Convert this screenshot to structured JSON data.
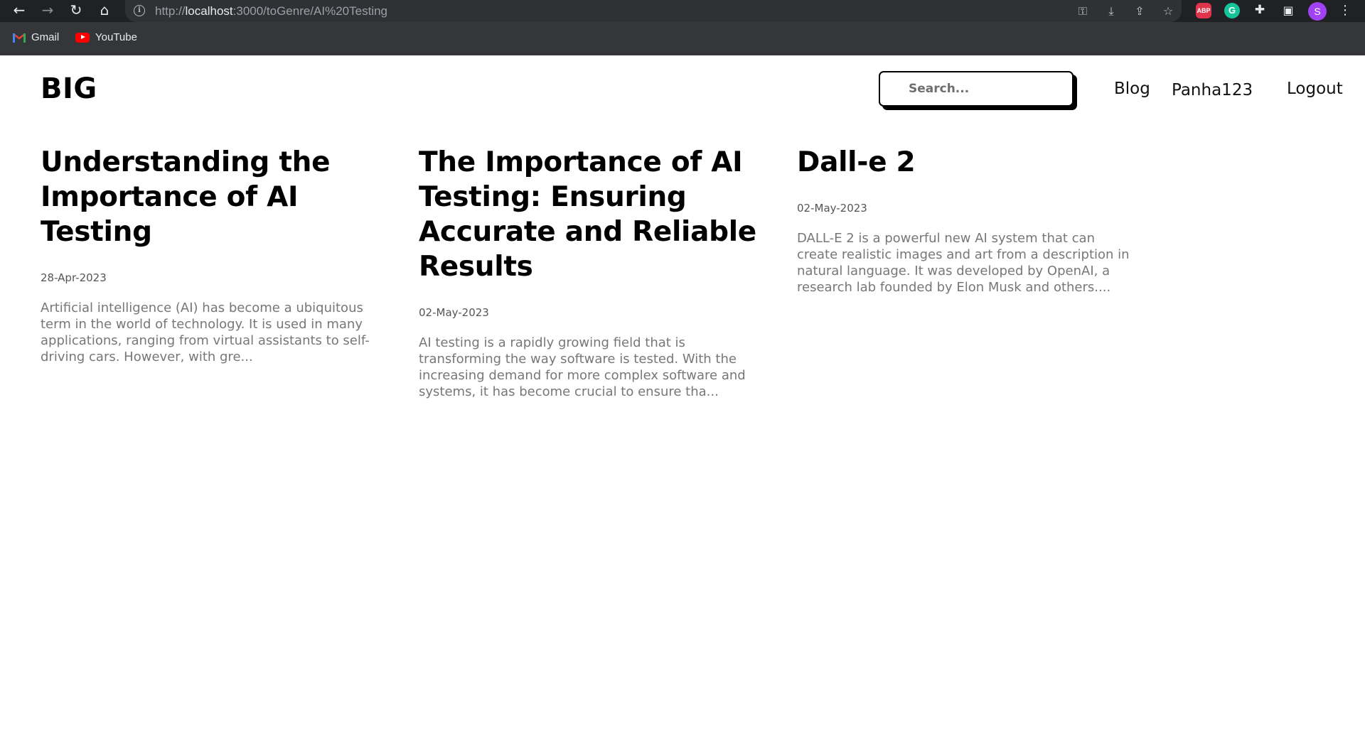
{
  "browser": {
    "url_scheme": "http://",
    "url_host": "localhost",
    "url_rest": ":3000/toGenre/AI%20Testing",
    "bookmarks": [
      {
        "label": "Gmail",
        "icon": "gmail-icon"
      },
      {
        "label": "YouTube",
        "icon": "youtube-icon"
      }
    ],
    "extensions": {
      "abp": "ABP",
      "grammarly": "G",
      "profile_initial": "S"
    },
    "colors": {
      "abp": "#e0344c",
      "grammarly": "#15c39a",
      "profile": "#a142f4"
    }
  },
  "site": {
    "logo": "BIG",
    "search_placeholder": "Search...",
    "nav": {
      "blog": "Blog",
      "user": "Panha123",
      "logout": "Logout"
    }
  },
  "posts": [
    {
      "title": "Understanding the Importance of AI Testing",
      "date": "28-Apr-2023",
      "excerpt": "Artificial intelligence (AI) has become a ubiquitous term in the world of technology. It is used in many applications, ranging from virtual assistants to self-driving cars. However, with gre..."
    },
    {
      "title": "The Importance of AI Testing: Ensuring Accurate and Reliable Results",
      "date": "02-May-2023",
      "excerpt": "AI testing is a rapidly growing field that is transforming the way software is tested. With the increasing demand for more complex software and systems, it has become crucial to ensure tha..."
    },
    {
      "title": "Dall-e 2",
      "date": "02-May-2023",
      "excerpt": "DALL-E 2 is a powerful new AI system that can create realistic images and art from a description in natural language. It was developed by OpenAI, a research lab founded by Elon Musk and others...."
    }
  ]
}
